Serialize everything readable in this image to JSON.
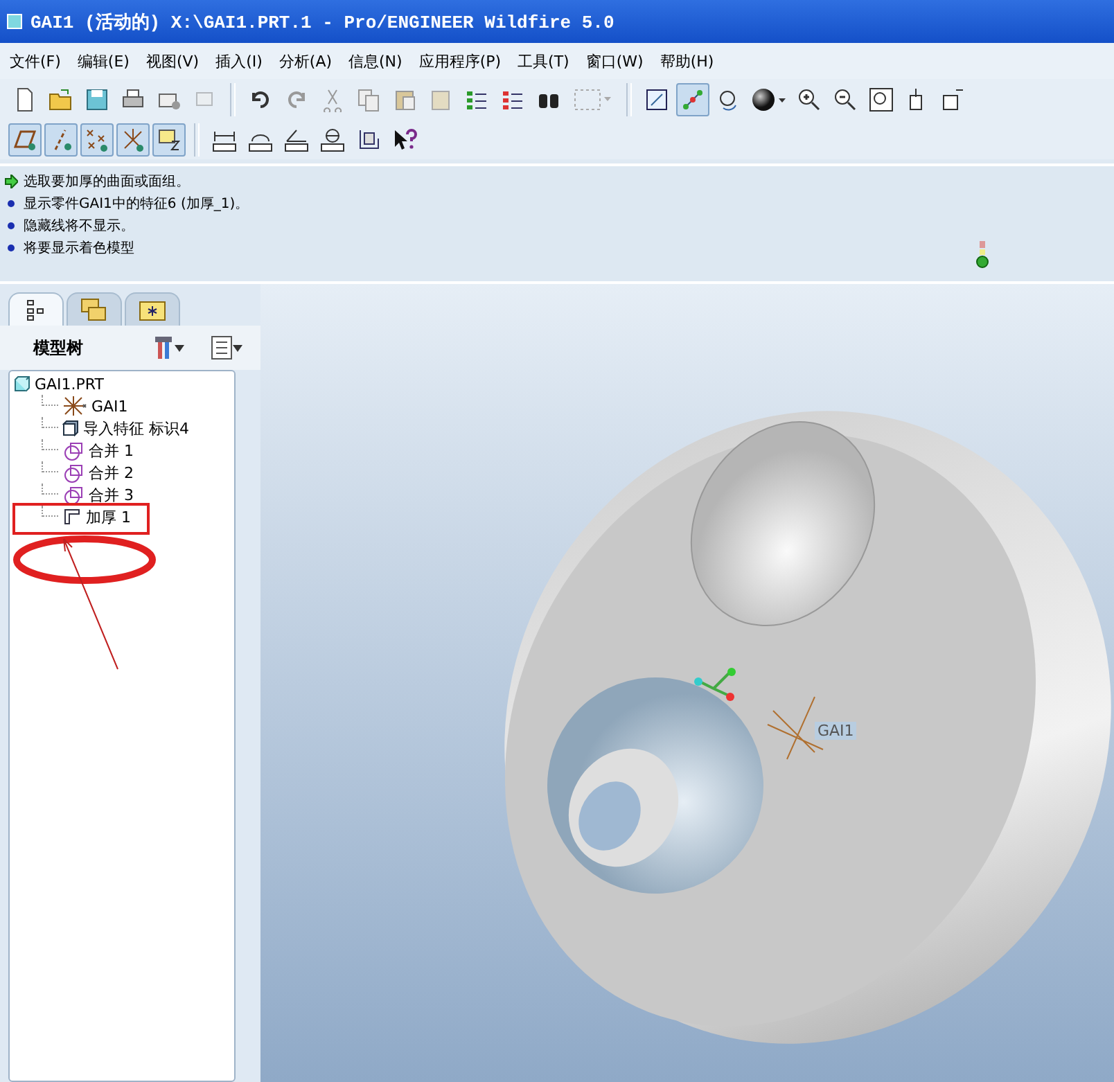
{
  "window": {
    "title": "GAI1 (活动的) X:\\GAI1.PRT.1 - Pro/ENGINEER Wildfire 5.0"
  },
  "menu": [
    "文件(F)",
    "编辑(E)",
    "视图(V)",
    "插入(I)",
    "分析(A)",
    "信息(N)",
    "应用程序(P)",
    "工具(T)",
    "窗口(W)",
    "帮助(H)"
  ],
  "view_toggles": [
    {
      "on": false
    },
    {
      "on": true
    },
    {
      "on": false
    }
  ],
  "datum_toggles": [
    {
      "on": true
    },
    {
      "on": true
    },
    {
      "on": true
    },
    {
      "on": true
    },
    {
      "on": true
    }
  ],
  "messages": [
    {
      "kind": "prompt",
      "text": "选取要加厚的曲面或面组。"
    },
    {
      "kind": "info",
      "text": "显示零件GAI1中的特征6 (加厚_1)。"
    },
    {
      "kind": "info",
      "text": "隐藏线将不显示。"
    },
    {
      "kind": "info",
      "text": "将要显示着色模型"
    }
  ],
  "navigator": {
    "tabs": [
      {
        "kind": "tree",
        "selected": true
      },
      {
        "kind": "folders",
        "selected": false
      },
      {
        "kind": "favorites",
        "selected": false
      }
    ],
    "title": "模型树",
    "tree": [
      {
        "kind": "part",
        "label": "GAI1.PRT",
        "children": [
          {
            "kind": "csys",
            "label": "GAI1"
          },
          {
            "kind": "import",
            "label": "导入特征 标识4"
          },
          {
            "kind": "merge",
            "label": "合并 1"
          },
          {
            "kind": "merge",
            "label": "合并 2"
          },
          {
            "kind": "merge",
            "label": "合并 3"
          },
          {
            "kind": "thicken",
            "label": "加厚 1"
          }
        ]
      }
    ]
  },
  "viewport": {
    "csys_label": "GAI1"
  }
}
